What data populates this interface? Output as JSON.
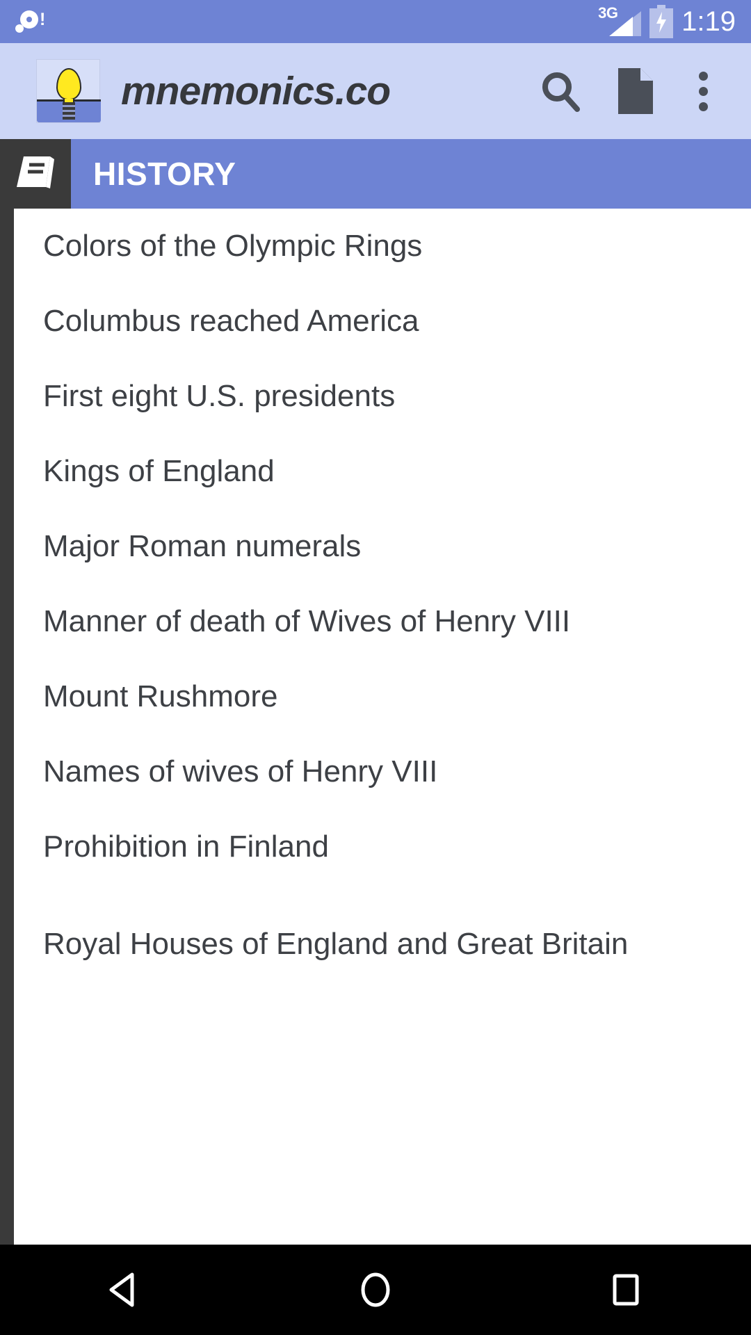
{
  "status_bar": {
    "notification_icon": "disc-alert-icon",
    "network_label": "3G",
    "signal_icon": "signal-triangle-icon",
    "battery_icon": "battery-charging-icon",
    "time": "1:19",
    "background_color": "#6e83d4",
    "text_color": "#ffffff"
  },
  "toolbar": {
    "logo_icon": "lightbulb-logo-icon",
    "title": "mnemonics.co",
    "search_icon": "search-icon",
    "document_icon": "document-icon",
    "overflow_icon": "overflow-menu-icon",
    "background_color": "#ccd6f6",
    "title_color": "#36383c"
  },
  "category": {
    "icon": "book-icon",
    "label": "HISTORY",
    "band_color": "#6e83d4",
    "icon_tile_color": "#3a3a3a"
  },
  "list": {
    "items": [
      {
        "label": "Colors of the Olympic Rings"
      },
      {
        "label": "Columbus reached America"
      },
      {
        "label": "First eight U.S. presidents"
      },
      {
        "label": "Kings of England"
      },
      {
        "label": "Major Roman numerals"
      },
      {
        "label": "Manner of death of Wives of Henry VIII"
      },
      {
        "label": "Mount Rushmore"
      },
      {
        "label": "Names of wives of Henry VIII"
      },
      {
        "label": "Prohibition in Finland"
      },
      {
        "label": "Royal Houses of England and Great Britain"
      }
    ],
    "text_color": "#3d4045",
    "background_color": "#ffffff",
    "scrollbar_color": "#3a3a3a"
  },
  "navigation_bar": {
    "back_icon": "back-triangle-icon",
    "home_icon": "home-circle-icon",
    "recents_icon": "recents-square-icon",
    "background_color": "#000000"
  }
}
